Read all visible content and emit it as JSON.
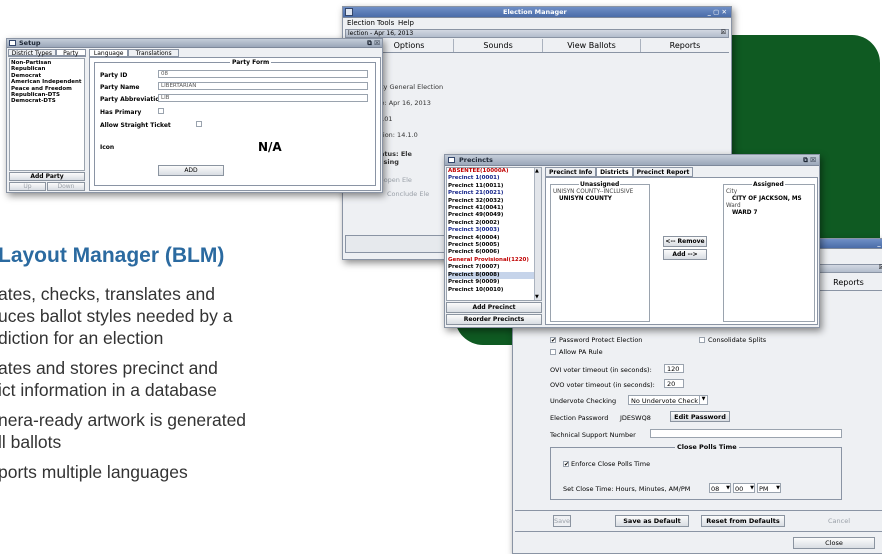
{
  "slide": {
    "heading": "Layout Manager (BLM)",
    "bullets": [
      [
        "ates, checks, translates and",
        "uces ballot styles needed by a",
        "diction for an election"
      ],
      [
        "ates and stores precinct and",
        "ict information in a database"
      ],
      [
        "nera-ready artwork is generated",
        "ll ballots"
      ],
      [
        "ports multiple languages"
      ]
    ]
  },
  "setup": {
    "title": "Setup",
    "left_tabs": [
      "District Types",
      "Party"
    ],
    "right_tabs": [
      "Language",
      "Translations"
    ],
    "parties": [
      "Non-Partisan",
      "Republican",
      "Democrat",
      "American Independent",
      "Peace and Freedom",
      "Republican-DTS",
      "Democrat-DTS"
    ],
    "add_party": "Add Party",
    "up": "Up",
    "down": "Down",
    "form_title": "Party Form",
    "party_id_label": "Party ID",
    "party_id_value": "08",
    "party_name_label": "Party Name",
    "party_name_value": "LIBERTARIAN",
    "party_abbr_label": "Party Abbreviation",
    "party_abbr_value": "LIB",
    "has_primary": "Has Primary",
    "allow_straight": "Allow Straight Ticket",
    "icon_label": "Icon",
    "icon_value": "N/A",
    "add_button": "ADD"
  },
  "election_manager": {
    "title": "Election Manager",
    "menu": [
      "Election",
      "Tools",
      "Help"
    ],
    "subtitle": "lection - Apr 16, 2013",
    "tabs": [
      "ne",
      "Options",
      "Sounds",
      "View Ballots",
      "Reports"
    ],
    "lines": [
      "berty County General Election",
      "lection Date:  Apr 16, 2013",
      "lection ID:  101",
      "lection Version:  14.1.0",
      "lection Status: Ele",
      "umber Missing"
    ],
    "buttons": [
      "Re-open Ele",
      "Conclude Ele"
    ]
  },
  "precincts": {
    "title": "Precincts",
    "items": [
      {
        "text": "ABSENTEE(10000A)",
        "style": "red"
      },
      {
        "text": "Precinct 1(0001)",
        "style": "blue"
      },
      {
        "text": "Precinct 11(0011)",
        "style": "black"
      },
      {
        "text": "Precinct 21(0021)",
        "style": "blue"
      },
      {
        "text": "Precinct 32(0032)",
        "style": "black"
      },
      {
        "text": "Precinct 41(0041)",
        "style": "black"
      },
      {
        "text": "Precinct 49(0049)",
        "style": "black"
      },
      {
        "text": "Precinct 2(0002)",
        "style": "black"
      },
      {
        "text": "Precinct 3(0003)",
        "style": "blue"
      },
      {
        "text": "Precinct 4(0004)",
        "style": "black"
      },
      {
        "text": "Precinct 5(0005)",
        "style": "black"
      },
      {
        "text": "Precinct 6(0006)",
        "style": "black"
      },
      {
        "text": "General Provisional(1220)",
        "style": "red"
      },
      {
        "text": "Precinct 7(0007)",
        "style": "black"
      },
      {
        "text": "Precinct 8(0008)",
        "style": "sel"
      },
      {
        "text": "Precinct 9(0009)",
        "style": "black"
      },
      {
        "text": "Precinct 10(0010)",
        "style": "black"
      }
    ],
    "add_precinct": "Add Precinct",
    "reorder": "Reorder Precincts",
    "tabs": [
      "Precinct Info",
      "Districts",
      "Precinct Report"
    ],
    "unassigned_title": "Unassigned",
    "unassigned": [
      "UNISYN COUNTY--INCLUSIVE",
      "UNISYN COUNTY"
    ],
    "remove_button": "<-- Remove",
    "add_button": "Add -->",
    "assigned_title": "Assigned",
    "assigned": [
      {
        "text": "City",
        "type": "cat"
      },
      {
        "text": "CITY OF JACKSON, MS",
        "type": "val"
      },
      {
        "text": "Ward",
        "type": "cat"
      },
      {
        "text": "WARD 7",
        "type": "val"
      }
    ]
  },
  "options": {
    "reports_tab": "Reports",
    "password_protect": "Password Protect Election",
    "consolidate_splits": "Consolidate Splits",
    "allow_pa": "Allow PA Rule",
    "ovi_label": "OVI voter timeout (in seconds):",
    "ovi_value": "120",
    "ovo_label": "OVO voter timeout (in seconds):",
    "ovo_value": "20",
    "undervote_label": "Undervote Checking",
    "undervote_value": "No Undervote Check",
    "password_label": "Election Password",
    "password_value": "JDESWQ8",
    "edit_password": "Edit Password",
    "tech_support": "Technical Support Number",
    "close_polls_title": "Close Polls Time",
    "enforce_close": "Enforce Close Polls Time",
    "set_close_label": "Set Close Time: Hours, Minutes, AM/PM",
    "hour": "08",
    "minute": "00",
    "ampm": "PM",
    "save": "Save",
    "save_default": "Save as Default",
    "reset_defaults": "Reset from Defaults",
    "cancel": "Cancel",
    "close": "Close"
  },
  "colors": {
    "green": "#0f5a22",
    "heading": "#2b6aa0",
    "accent_red": "#c00000",
    "accent_blue": "#14248a"
  }
}
